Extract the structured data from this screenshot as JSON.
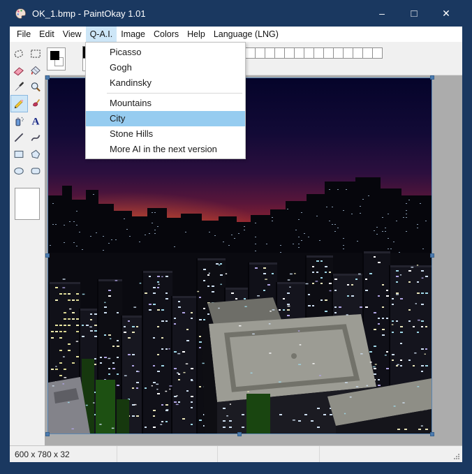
{
  "window": {
    "title": "OK_1.bmp - PaintOkay 1.01",
    "controls": {
      "minimize": "–",
      "maximize": "□",
      "close": "✕"
    }
  },
  "menu_bar": {
    "items": [
      {
        "label": "File"
      },
      {
        "label": "Edit"
      },
      {
        "label": "View"
      },
      {
        "label": "Q-A.I."
      },
      {
        "label": "Image"
      },
      {
        "label": "Colors"
      },
      {
        "label": "Help"
      },
      {
        "label": "Language (LNG)"
      }
    ],
    "active": "Q-A.I."
  },
  "qai_menu": {
    "items": [
      {
        "label": "Picasso"
      },
      {
        "label": "Gogh"
      },
      {
        "label": "Kandinsky"
      },
      {
        "separator": true
      },
      {
        "label": "Mountains"
      },
      {
        "label": "City",
        "highlighted": true
      },
      {
        "label": "Stone Hills"
      },
      {
        "label": "More AI in the next version"
      }
    ]
  },
  "toolbox": {
    "tools": [
      "free-form-select",
      "rect-select",
      "eraser",
      "fill",
      "color-picker",
      "magnifier",
      "pencil",
      "brush",
      "airbrush",
      "text",
      "line",
      "curve",
      "rectangle",
      "polygon",
      "ellipse",
      "rounded-rectangle"
    ],
    "selected": "pencil"
  },
  "color_area": {
    "foreground": "#000000",
    "background": "#ffffff",
    "palette_black": "#000000",
    "palette_white": "#ffffff",
    "empty_swatch_count": 14
  },
  "status_bar": {
    "panels": [
      {
        "text": "600 x 780 x 32"
      },
      {
        "text": ""
      },
      {
        "text": ""
      },
      {
        "text": ""
      }
    ]
  },
  "theme": {
    "titlebar": "#1a3860",
    "menu_highlight": "#cde6f7",
    "dropdown_highlight": "#96ccf0",
    "workspace": "#acacac",
    "selection_handle": "#4d7cb0",
    "sky_top": "#05042a",
    "sky_horizon": "#e85a1d",
    "city_silhouette": "#06060c"
  }
}
